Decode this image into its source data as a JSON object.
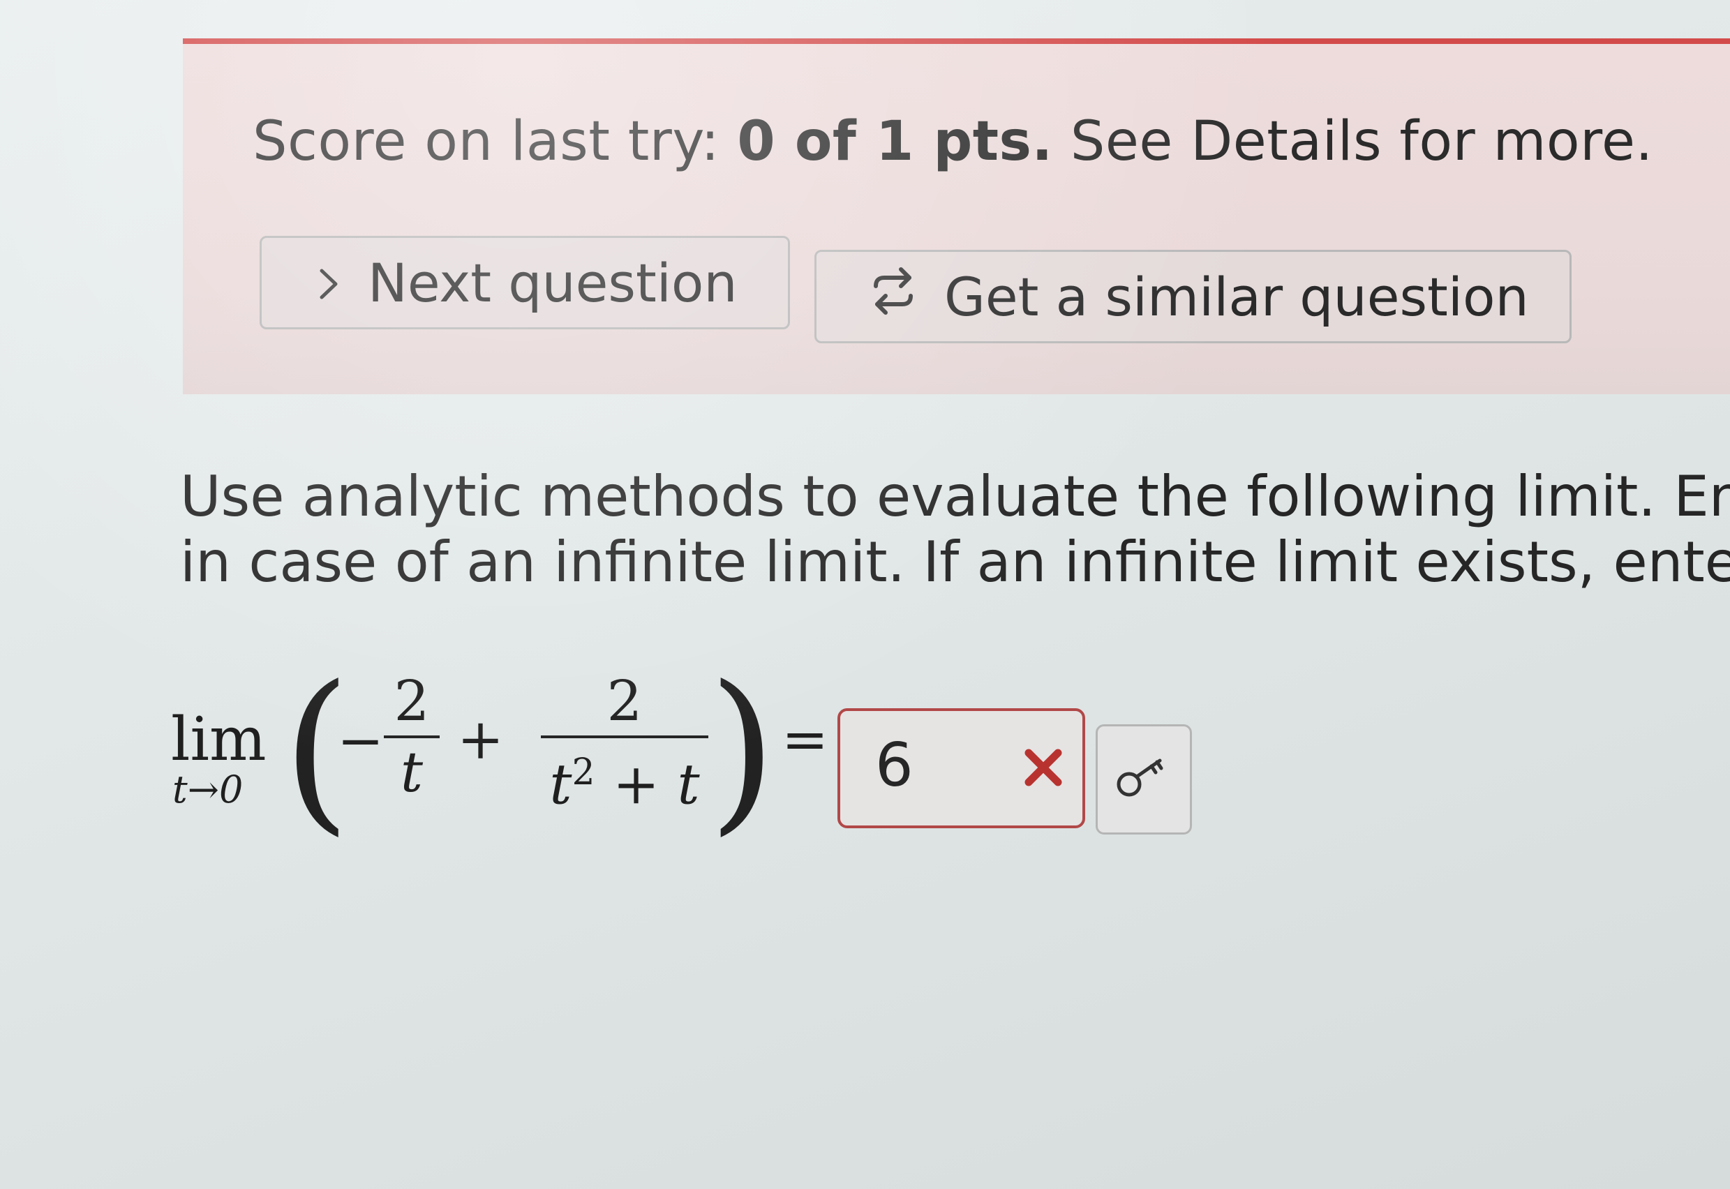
{
  "score": {
    "prefix": "Score on last try: ",
    "points": "0 of 1 pts.",
    "suffix": " See Details for more."
  },
  "buttons": {
    "next_question": "Next question",
    "similar_question": "Get a similar question"
  },
  "question": {
    "line1": "Use analytic methods to evaluate the following limit. Enter",
    "line2": "in case of an infinite limit. If an infinite limit exists, enter c"
  },
  "math": {
    "lim": "lim",
    "lim_sub": "t→0",
    "minus": "−",
    "frac1_num": "2",
    "frac1_den": "t",
    "plus": "+",
    "frac2_num": "2",
    "frac2_den_base": "t",
    "frac2_den_exp": "2",
    "frac2_den_rest": " + t",
    "equals": "="
  },
  "answer": {
    "value": "6",
    "status": "incorrect"
  },
  "icons": {
    "next": "chevron-right-icon",
    "similar": "refresh-arrows-icon",
    "wrong": "x-mark-icon",
    "key": "key-icon"
  },
  "colors": {
    "panel_border": "#d34a4a",
    "panel_background": "#eedcdc",
    "incorrect": "#b8332f"
  }
}
